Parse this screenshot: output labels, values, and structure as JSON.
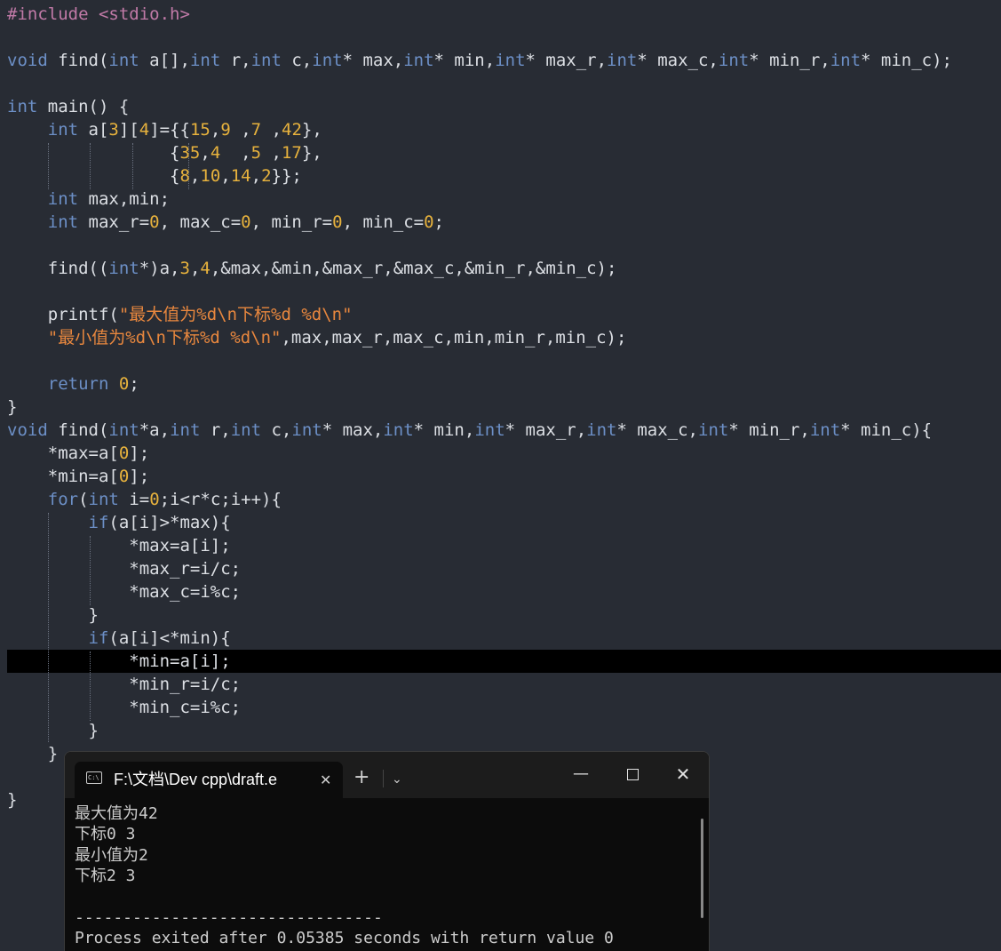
{
  "editor": {
    "lines": [
      [
        [
          "pp",
          "#include <stdio.h>"
        ]
      ],
      [],
      [
        [
          "kw",
          "void"
        ],
        [
          "pl",
          " find("
        ],
        [
          "kw",
          "int"
        ],
        [
          "pl",
          " a[],"
        ],
        [
          "kw",
          "int"
        ],
        [
          "pl",
          " r,"
        ],
        [
          "kw",
          "int"
        ],
        [
          "pl",
          " c,"
        ],
        [
          "kw",
          "int"
        ],
        [
          "pl",
          "* max,"
        ],
        [
          "kw",
          "int"
        ],
        [
          "pl",
          "* min,"
        ],
        [
          "kw",
          "int"
        ],
        [
          "pl",
          "* max_r,"
        ],
        [
          "kw",
          "int"
        ],
        [
          "pl",
          "* max_c,"
        ],
        [
          "kw",
          "int"
        ],
        [
          "pl",
          "* min_r,"
        ],
        [
          "kw",
          "int"
        ],
        [
          "pl",
          "* min_c);"
        ]
      ],
      [],
      [
        [
          "kw",
          "int"
        ],
        [
          "pl",
          " main() {"
        ]
      ],
      [
        [
          "pl",
          "    "
        ],
        [
          "kw",
          "int"
        ],
        [
          "pl",
          " a["
        ],
        [
          "num",
          "3"
        ],
        [
          "pl",
          "]["
        ],
        [
          "num",
          "4"
        ],
        [
          "pl",
          "]={{"
        ],
        [
          "num",
          "15"
        ],
        [
          "pl",
          ","
        ],
        [
          "num",
          "9"
        ],
        [
          "pl",
          " ,"
        ],
        [
          "num",
          "7"
        ],
        [
          "pl",
          " ,"
        ],
        [
          "num",
          "42"
        ],
        [
          "pl",
          "},"
        ]
      ],
      [
        [
          "pl",
          "                {"
        ],
        [
          "num",
          "35"
        ],
        [
          "pl",
          ","
        ],
        [
          "num",
          "4"
        ],
        [
          "pl",
          "  ,"
        ],
        [
          "num",
          "5"
        ],
        [
          "pl",
          " ,"
        ],
        [
          "num",
          "17"
        ],
        [
          "pl",
          "},"
        ]
      ],
      [
        [
          "pl",
          "                {"
        ],
        [
          "num",
          "8"
        ],
        [
          "pl",
          ","
        ],
        [
          "num",
          "10"
        ],
        [
          "pl",
          ","
        ],
        [
          "num",
          "14"
        ],
        [
          "pl",
          ","
        ],
        [
          "num",
          "2"
        ],
        [
          "pl",
          "}};"
        ]
      ],
      [
        [
          "pl",
          "    "
        ],
        [
          "kw",
          "int"
        ],
        [
          "pl",
          " max,min;"
        ]
      ],
      [
        [
          "pl",
          "    "
        ],
        [
          "kw",
          "int"
        ],
        [
          "pl",
          " max_r="
        ],
        [
          "num",
          "0"
        ],
        [
          "pl",
          ", max_c="
        ],
        [
          "num",
          "0"
        ],
        [
          "pl",
          ", min_r="
        ],
        [
          "num",
          "0"
        ],
        [
          "pl",
          ", min_c="
        ],
        [
          "num",
          "0"
        ],
        [
          "pl",
          ";"
        ]
      ],
      [],
      [
        [
          "pl",
          "    find(("
        ],
        [
          "kw",
          "int"
        ],
        [
          "pl",
          "*)a,"
        ],
        [
          "num",
          "3"
        ],
        [
          "pl",
          ","
        ],
        [
          "num",
          "4"
        ],
        [
          "pl",
          ",&max,&min,&max_r,&max_c,&min_r,&min_c);"
        ]
      ],
      [],
      [
        [
          "pl",
          "    printf("
        ],
        [
          "str",
          "\"最大值为%d\\n下标%d %d\\n\""
        ]
      ],
      [
        [
          "pl",
          "    "
        ],
        [
          "str",
          "\"最小值为%d\\n下标%d %d\\n\""
        ],
        [
          "pl",
          ",max,max_r,max_c,min,min_r,min_c);"
        ]
      ],
      [],
      [
        [
          "pl",
          "    "
        ],
        [
          "kw",
          "return"
        ],
        [
          "pl",
          " "
        ],
        [
          "num",
          "0"
        ],
        [
          "pl",
          ";"
        ]
      ],
      [
        [
          "pl",
          "}"
        ]
      ],
      [
        [
          "kw",
          "void"
        ],
        [
          "pl",
          " find("
        ],
        [
          "kw",
          "int"
        ],
        [
          "pl",
          "*a,"
        ],
        [
          "kw",
          "int"
        ],
        [
          "pl",
          " r,"
        ],
        [
          "kw",
          "int"
        ],
        [
          "pl",
          " c,"
        ],
        [
          "kw",
          "int"
        ],
        [
          "pl",
          "* max,"
        ],
        [
          "kw",
          "int"
        ],
        [
          "pl",
          "* min,"
        ],
        [
          "kw",
          "int"
        ],
        [
          "pl",
          "* max_r,"
        ],
        [
          "kw",
          "int"
        ],
        [
          "pl",
          "* max_c,"
        ],
        [
          "kw",
          "int"
        ],
        [
          "pl",
          "* min_r,"
        ],
        [
          "kw",
          "int"
        ],
        [
          "pl",
          "* min_c){"
        ]
      ],
      [
        [
          "pl",
          "    *max=a["
        ],
        [
          "num",
          "0"
        ],
        [
          "pl",
          "];"
        ]
      ],
      [
        [
          "pl",
          "    *min=a["
        ],
        [
          "num",
          "0"
        ],
        [
          "pl",
          "];"
        ]
      ],
      [
        [
          "pl",
          "    "
        ],
        [
          "kw",
          "for"
        ],
        [
          "pl",
          "("
        ],
        [
          "kw",
          "int"
        ],
        [
          "pl",
          " i="
        ],
        [
          "num",
          "0"
        ],
        [
          "pl",
          ";i<r*c;i++){"
        ]
      ],
      [
        [
          "pl",
          "        "
        ],
        [
          "kw",
          "if"
        ],
        [
          "pl",
          "(a[i]>*max){"
        ]
      ],
      [
        [
          "pl",
          "            *max=a[i];"
        ]
      ],
      [
        [
          "pl",
          "            *max_r=i/c;"
        ]
      ],
      [
        [
          "pl",
          "            *max_c=i%c;"
        ]
      ],
      [
        [
          "pl",
          "        }"
        ]
      ],
      [
        [
          "pl",
          "        "
        ],
        [
          "kw",
          "if"
        ],
        [
          "pl",
          "(a[i]<*min){"
        ]
      ],
      [
        [
          "pl",
          "            *min=a[i];"
        ]
      ],
      [
        [
          "pl",
          "            *min_r=i/c;"
        ]
      ],
      [
        [
          "pl",
          "            *min_c=i%c;"
        ]
      ],
      [
        [
          "pl",
          "        }"
        ]
      ],
      [
        [
          "pl",
          "    }"
        ]
      ],
      [],
      [
        [
          "pl",
          "}"
        ]
      ]
    ]
  },
  "console": {
    "tab_title": "F:\\文档\\Dev cpp\\draft.e",
    "tab_icon_text": "C:\\",
    "tab_close_glyph": "✕",
    "new_tab_glyph": "+",
    "dropdown_glyph": "⌄",
    "minimize_glyph": "—",
    "close_glyph": "✕",
    "output": [
      "最大值为42",
      "下标0 3",
      "最小值为2",
      "下标2 3",
      "",
      "--------------------------------",
      "Process exited after 0.05385 seconds with return value 0"
    ]
  },
  "colors": {
    "editor_bg": "#282c34",
    "keyword": "#6c8fc6",
    "preprocessor": "#c17aa7",
    "number": "#e7b23d",
    "string": "#e8873e",
    "plain": "#dcdfe4",
    "current_line": "#000000",
    "console_bg": "#0c0c0c",
    "console_titlebar": "#1c1c1c",
    "console_text": "#cccccc"
  }
}
